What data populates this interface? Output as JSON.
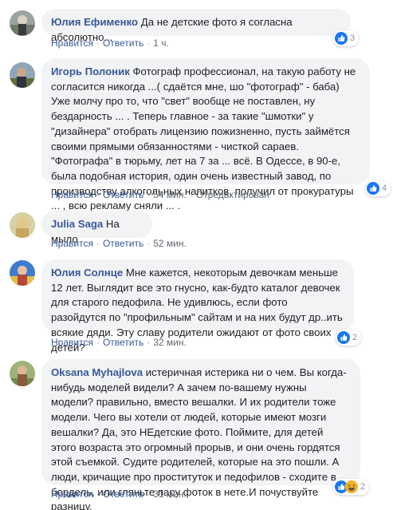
{
  "comments": [
    {
      "author": "Юлия Ефименко",
      "text": "Да не детские фото я согласна абсолютно...",
      "like": "Нравится",
      "reply": "Ответить",
      "time": "1 ч.",
      "edited": "",
      "reaction_count": "3",
      "reaction_type": "like"
    },
    {
      "author": "Игорь Полоник",
      "text": "Фотограф профессионал, на такую работу не согласится никогда ...( сдаётся мне, шо \"фотограф\" - баба) Уже молчу про то, что \"свет\" вообще не поставлен, ну бездарность ... . Теперь главное - за такие \"шмотки\" у \"дизайнера\" отобрать лицензию пожизненно, пусть займётся своими прямыми обязанностями - чисткой сараев. \"Фотографа\" в тюрьму, лет на 7 за ... всё. В Одессе, в 90-е, была подобная история, один очень известный завод, по производству алкогольных напитков, получил от прокуратуры ... , всю рекламу сняли ... .",
      "like": "Нравится",
      "reply": "Ответить",
      "time": "54 мин.",
      "edited": "Отредактирован",
      "reaction_count": "4",
      "reaction_type": "like"
    },
    {
      "author": "Julia Saga",
      "text": "На мыло",
      "like": "Нравится",
      "reply": "Ответить",
      "time": "52 мин.",
      "edited": "",
      "reaction_count": "",
      "reaction_type": ""
    },
    {
      "author": "Юлия Солнце",
      "text": "Мне кажется, некоторым девочкам меньше 12 лет. Выглядит все это гнусно, как-будто каталог девочек для старого педофила. Не удивлюсь, если фото разойдутся по \"профильным\" сайтам и на них будут др..ить всякие дяди. Эту славу родители ожидают от фото своих детей?",
      "like": "Нравится",
      "reply": "Ответить",
      "time": "32 мин.",
      "edited": "",
      "reaction_count": "2",
      "reaction_type": "like"
    },
    {
      "author": "Oksana Myhajlova",
      "text": "истеричная истерика ни о чем. Вы когда-нибудь моделей видели? А зачем по-вашему нужны модели? правильно, вместо вешалки. И их родители тоже модели. Чего вы хотели от людей, которые имеют мозги вешалки? Да, это НЕдетские фото. Поймите, для детей этого возраста это огромный прорыв, и они очень гордятся этой съемкой. Судите родителей, которые на это пошли. А люди, кричащие про проституток и педофилов - сходите в бордель, или гляньте пару фоток в нете.И почуствуйте разницу.",
      "like": "Нравится",
      "reply": "Ответить",
      "time": "31 мин.",
      "edited": "",
      "reaction_count": "2",
      "reaction_type": "like-haha"
    }
  ],
  "colors": {
    "author": "#385898",
    "bubble": "#f2f3f5",
    "like": "#1877f2",
    "haha": "#f7b125"
  }
}
